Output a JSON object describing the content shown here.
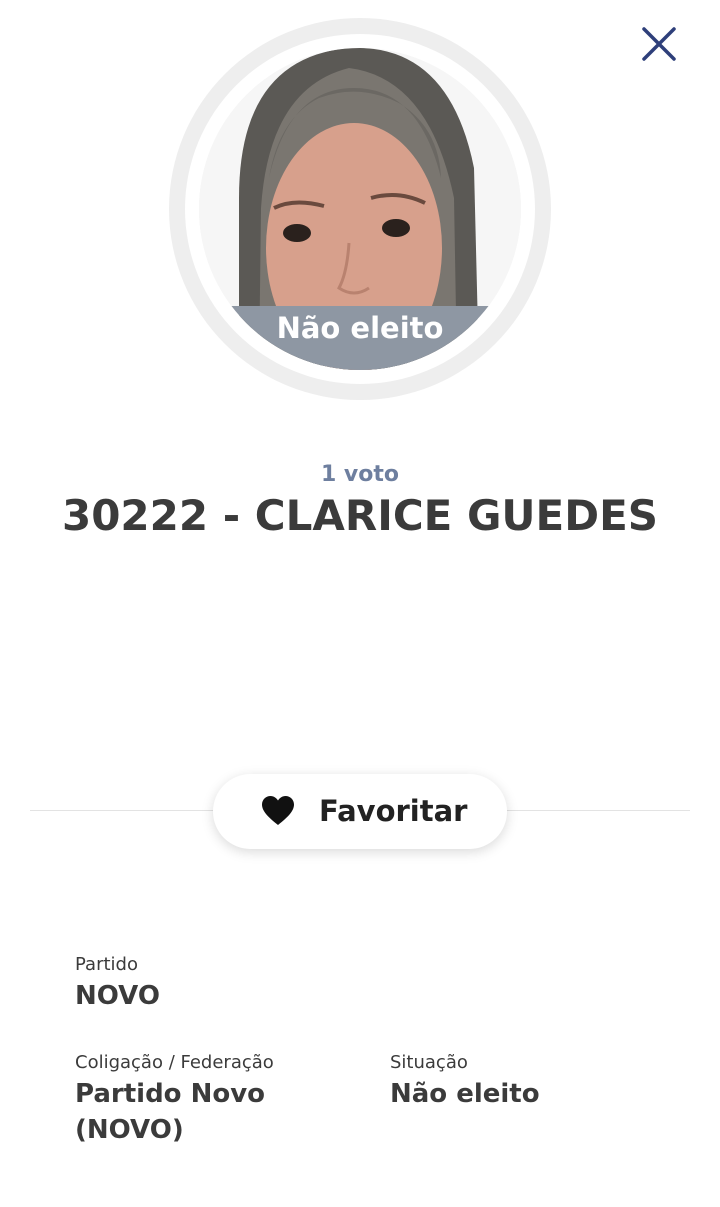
{
  "header": {
    "close_icon": "close-icon"
  },
  "candidate": {
    "photo_status_badge": "Não eleito",
    "votes": "1 voto",
    "name": "30222 - CLARICE GUEDES"
  },
  "actions": {
    "favorite_icon": "heart-icon",
    "favorite_label": "Favoritar"
  },
  "details": {
    "party_label": "Partido",
    "party_value": "NOVO",
    "coalition_label": "Coligação / Federação",
    "coalition_value": "Partido Novo (NOVO)",
    "status_label": "Situação",
    "status_value": "Não eleito"
  },
  "colors": {
    "accent_navy": "#2e3f7a",
    "status_overlay": "#8e97a3",
    "votes_text": "#6e7f9f",
    "text_dark": "#3b3b3b"
  }
}
